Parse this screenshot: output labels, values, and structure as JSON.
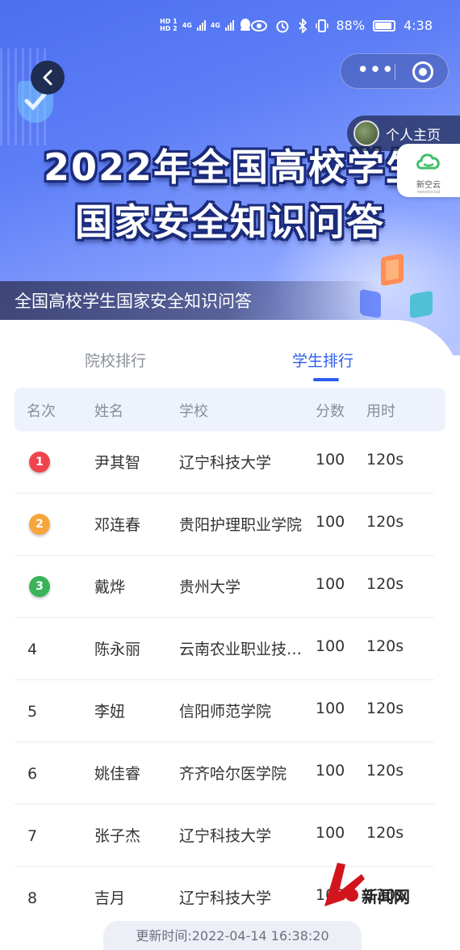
{
  "status_bar": {
    "hd1": "HD 1",
    "hd2": "HD 2",
    "net1": "4G",
    "net2": "4G",
    "battery": "88%",
    "time": "4:38"
  },
  "header": {
    "home_chip_label": "个人主页",
    "badge_label": "新空云",
    "badge_sub": "newskyclud"
  },
  "banner": {
    "title_line1": "2022年全国高校学生",
    "title_line2": "国家安全知识问答",
    "subtitle": "全国高校学生国家安全知识问答"
  },
  "tabs": [
    {
      "label": "院校排行",
      "active": false
    },
    {
      "label": "学生排行",
      "active": true
    }
  ],
  "table": {
    "headers": [
      "名次",
      "姓名",
      "学校",
      "分数",
      "用时"
    ],
    "rows": [
      {
        "rank": "1",
        "name": "尹其智",
        "school": "辽宁科技大学",
        "score": "100",
        "time": "120s"
      },
      {
        "rank": "2",
        "name": "邓连春",
        "school": "贵阳护理职业学院",
        "score": "100",
        "time": "120s"
      },
      {
        "rank": "3",
        "name": "戴烨",
        "school": "贵州大学",
        "score": "100",
        "time": "120s"
      },
      {
        "rank": "4",
        "name": "陈永丽",
        "school": "云南农业职业技…",
        "score": "100",
        "time": "120s"
      },
      {
        "rank": "5",
        "name": "李妞",
        "school": "信阳师范学院",
        "score": "100",
        "time": "120s"
      },
      {
        "rank": "6",
        "name": "姚佳睿",
        "school": "齐齐哈尔医学院",
        "score": "100",
        "time": "120s"
      },
      {
        "rank": "7",
        "name": "张子杰",
        "school": "辽宁科技大学",
        "score": "100",
        "time": "120s"
      },
      {
        "rank": "8",
        "name": "吉月",
        "school": "辽宁科技大学",
        "score": "100",
        "time": "120s"
      }
    ]
  },
  "footer": {
    "updated": "更新时间:2022-04-14 16:38:20"
  },
  "watermark": {
    "text": "新闻网"
  },
  "colors": {
    "accent": "#2e5cf0",
    "medal_gold": "#f0444c",
    "medal_silver": "#f7a63c",
    "medal_bronze": "#3ab35a",
    "header_bg": "#eef2fd"
  },
  "icons": [
    "back-icon",
    "more-dots-icon",
    "close-target-icon",
    "avatar",
    "cloud-logo-icon",
    "shield-icon"
  ]
}
